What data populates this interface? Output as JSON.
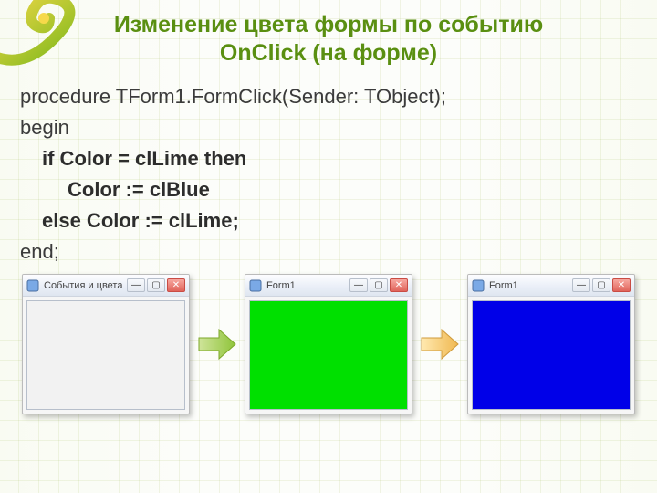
{
  "title_line1": "Изменение цвета формы по событию",
  "title_line2": "OnClick (на форме)",
  "code": {
    "l1": "procedure TForm1.FormClick(Sender: TObject);",
    "l2": "begin",
    "l3": "if Color = clLime then",
    "l4": "Color := clBlue",
    "l5": "else Color := clLime;",
    "l6": "end;"
  },
  "windows": {
    "w1": {
      "caption": "События и цвета"
    },
    "w2": {
      "caption": "Form1"
    },
    "w3": {
      "caption": "Form1"
    }
  },
  "winbtn": {
    "min": "—",
    "max": "▢",
    "close": "✕"
  }
}
